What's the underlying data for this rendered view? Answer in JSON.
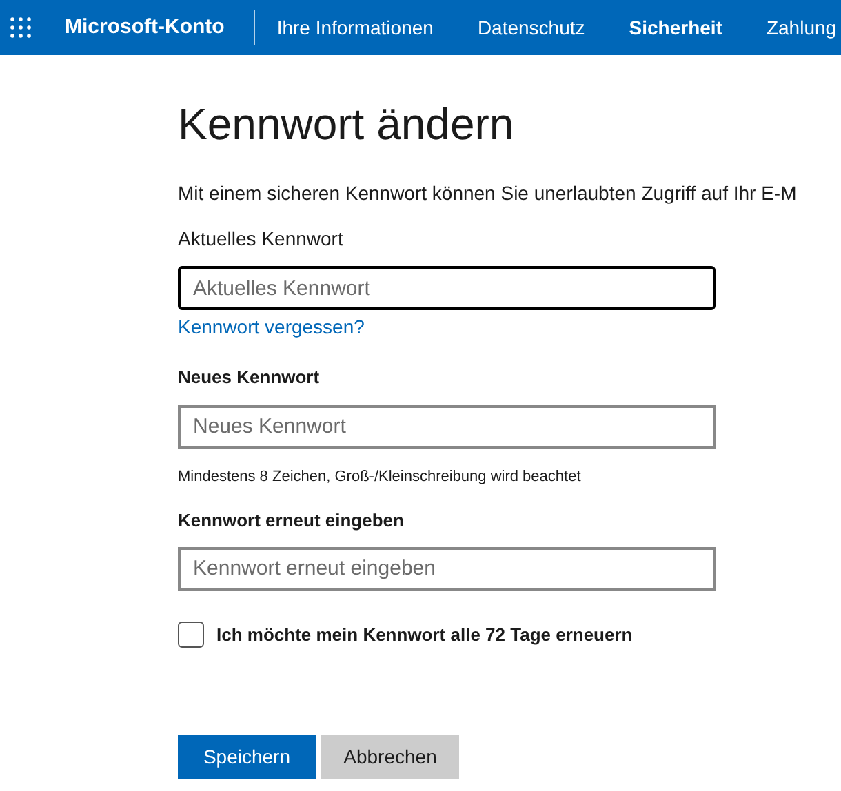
{
  "header": {
    "brand": "Microsoft-Konto",
    "nav": [
      {
        "label": "Ihre Informationen",
        "selected": false
      },
      {
        "label": "Datenschutz",
        "selected": false
      },
      {
        "label": "Sicherheit",
        "selected": true
      },
      {
        "label": "Zahlung",
        "selected": false
      }
    ]
  },
  "title": "Kennwort ändern",
  "intro": "Mit einem sicheren Kennwort können Sie unerlaubten Zugriff auf Ihr E-M",
  "current": {
    "label": "Aktuelles Kennwort",
    "placeholder": "Aktuelles Kennwort",
    "focused": true,
    "link": "Kennwort vergessen?"
  },
  "new": {
    "label": "Neues Kennwort",
    "placeholder": "Neues Kennwort",
    "focused": false,
    "hint": "Mindestens 8 Zeichen, Groß-/Kleinschreibung wird beachtet"
  },
  "repeat": {
    "label": "Kennwort erneut eingeben",
    "placeholder": "Kennwort erneut eingeben",
    "focused": false
  },
  "renew": {
    "label": "Ich möchte mein Kennwort alle 72 Tage erneuern",
    "checked": false
  },
  "buttons": [
    {
      "label": "Speichern",
      "kind": "primary"
    },
    {
      "label": "Abbrechen",
      "kind": "secondary"
    }
  ]
}
